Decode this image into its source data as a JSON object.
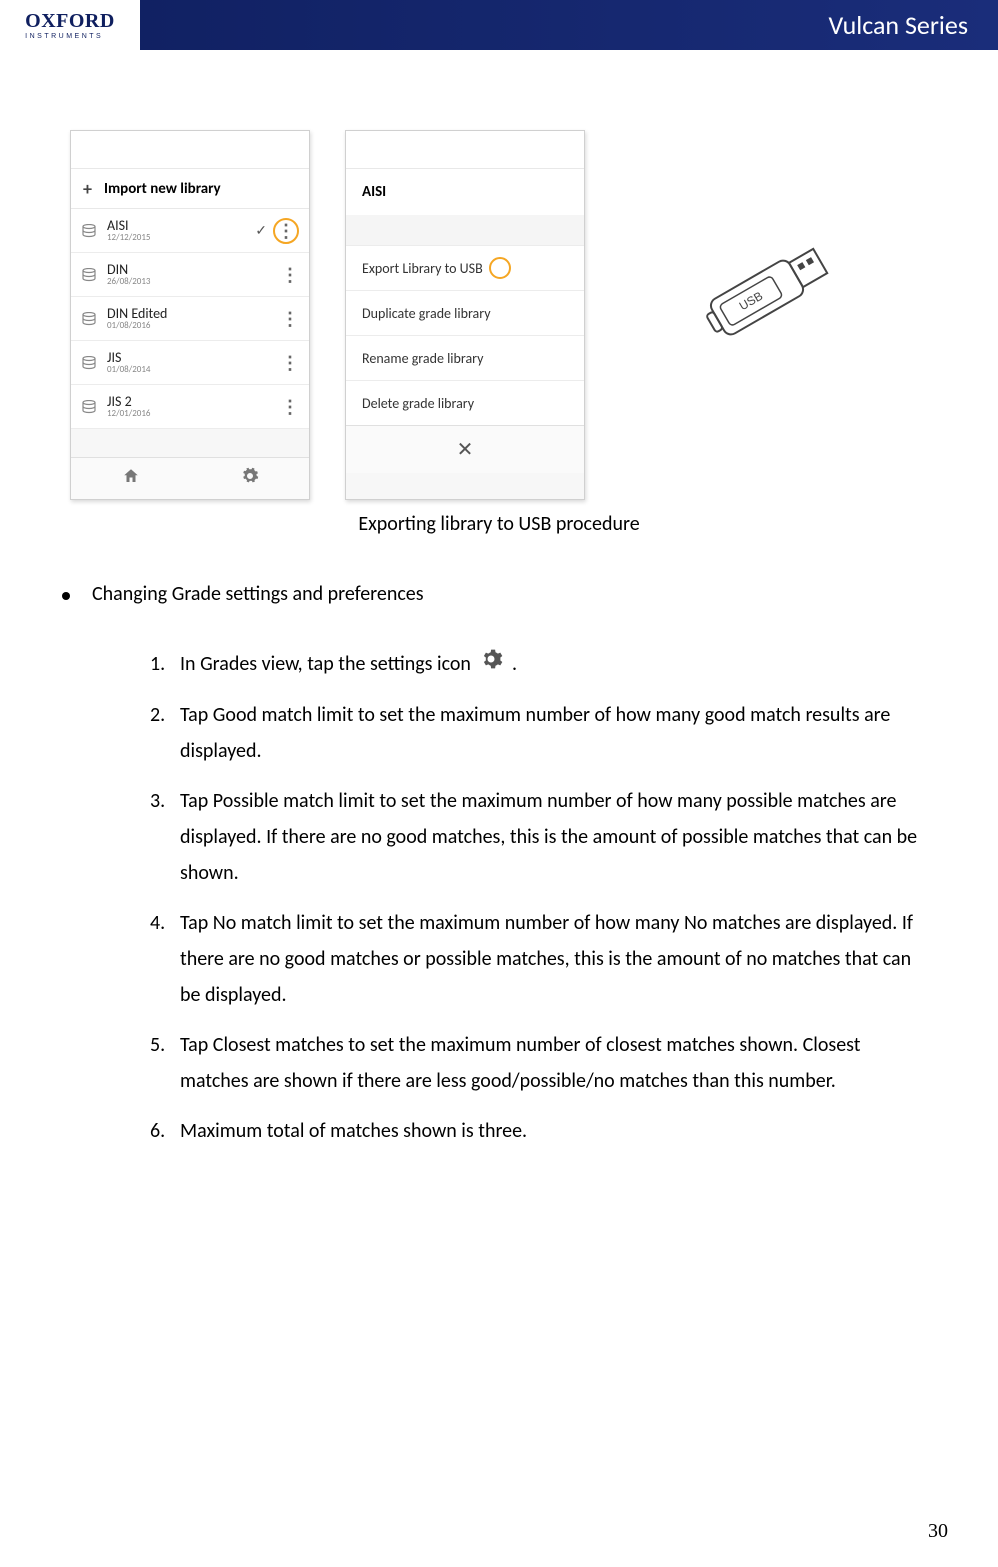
{
  "header": {
    "logo_main": "OXFORD",
    "logo_sub": "INSTRUMENTS",
    "title": "Vulcan Series"
  },
  "figure": {
    "import_label": "Import new library",
    "libs": [
      {
        "name": "AISI",
        "date": "12/12/2015",
        "checked": true,
        "highlight": true
      },
      {
        "name": "DIN",
        "date": "26/08/2013",
        "checked": false,
        "highlight": false
      },
      {
        "name": "DIN Edited",
        "date": "01/08/2016",
        "checked": false,
        "highlight": false
      },
      {
        "name": "JIS",
        "date": "01/08/2014",
        "checked": false,
        "highlight": false
      },
      {
        "name": "JIS 2",
        "date": "12/01/2016",
        "checked": false,
        "highlight": false
      }
    ],
    "menu_header": "AISI",
    "menu_items": [
      "Export Library to USB",
      "Duplicate grade library",
      "Rename grade library",
      "Delete grade library"
    ],
    "caption": "Exporting library to USB procedure"
  },
  "bullet": "Changing Grade settings and preferences",
  "steps": [
    {
      "n": "1.",
      "pre": "In Grades view, tap the settings icon ",
      "post": " ."
    },
    {
      "n": "2.",
      "text": "Tap Good match limit to set the maximum number of how many good match results are displayed."
    },
    {
      "n": "3.",
      "text": "Tap Possible match limit to set the maximum number of how many possible matches are displayed. If there are no good matches, this is the amount of possible matches that can be shown."
    },
    {
      "n": "4.",
      "text": "Tap No match limit to set the maximum number of how many No matches are displayed. If there are no good matches or possible matches, this is the amount of no matches that can be displayed."
    },
    {
      "n": "5.",
      "text": "Tap Closest matches to set the maximum number of closest matches shown. Closest matches are shown if there are less good/possible/no matches than this number."
    },
    {
      "n": "6.",
      "text": "Maximum total of matches shown is three."
    }
  ],
  "page_number": "30"
}
